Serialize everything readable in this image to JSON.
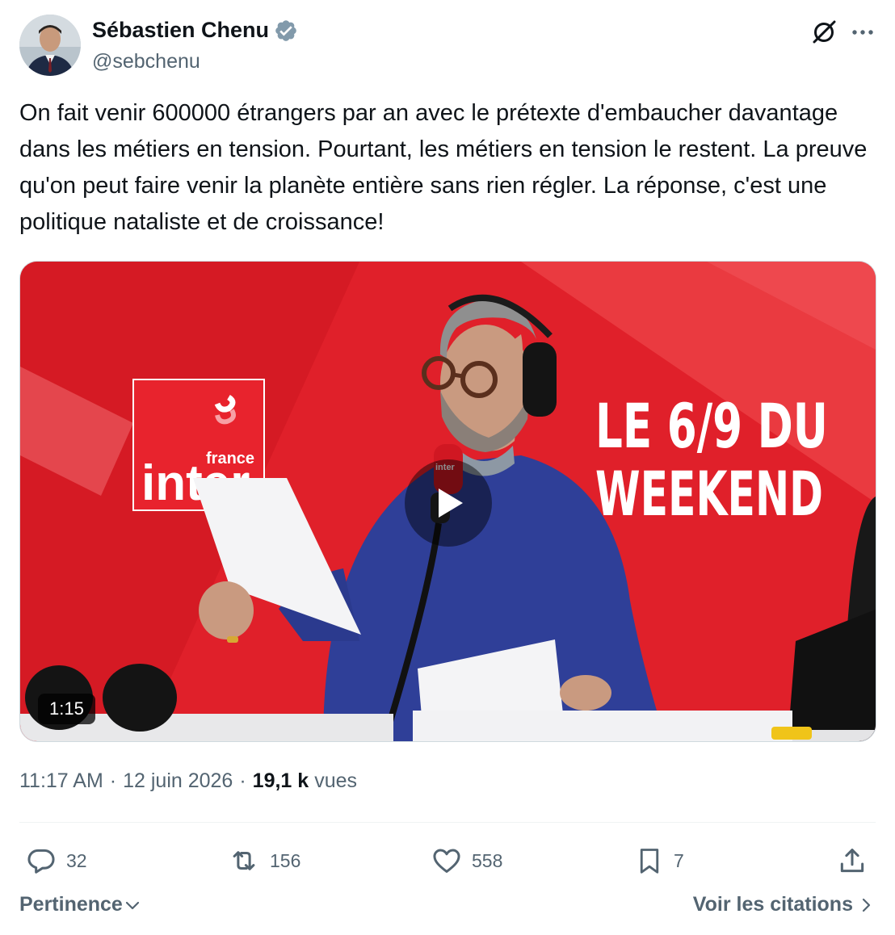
{
  "author": {
    "display_name": "Sébastien Chenu",
    "handle": "@sebchenu",
    "verified": true
  },
  "tweet": {
    "text": "On fait venir 600000 étrangers par an avec le prétexte d'embaucher davantage dans les métiers en tension. Pourtant, les métiers en tension le restent. La preuve qu'on peut faire venir la planète entière sans rien régler. La réponse, c'est une politique nataliste et de croissance!"
  },
  "media": {
    "type": "video",
    "duration": "1:15",
    "logo_small": "france",
    "logo_big": "inter",
    "banner_line1": "LE 6/9 DU",
    "banner_line2": "WEEKEND",
    "mic_label": "inter"
  },
  "meta": {
    "time": "11:17 AM",
    "date": "12 juin 2026",
    "views_count": "19,1 k",
    "views_label": "vues",
    "separator": "·"
  },
  "actions": {
    "replies": "32",
    "reposts": "156",
    "likes": "558",
    "bookmarks": "7"
  },
  "footer": {
    "sort_label": "Pertinence",
    "quotes_label": "Voir les citations"
  },
  "colors": {
    "text": "#0f1419",
    "secondary": "#536471",
    "verified": "#829aab",
    "media_red": "#e0202a"
  },
  "icons": [
    "grok-icon",
    "more-icon",
    "verified-badge-icon",
    "play-icon",
    "reply-icon",
    "repost-icon",
    "like-icon",
    "bookmark-icon",
    "share-icon",
    "chevron-down-icon",
    "chevron-right-icon"
  ]
}
